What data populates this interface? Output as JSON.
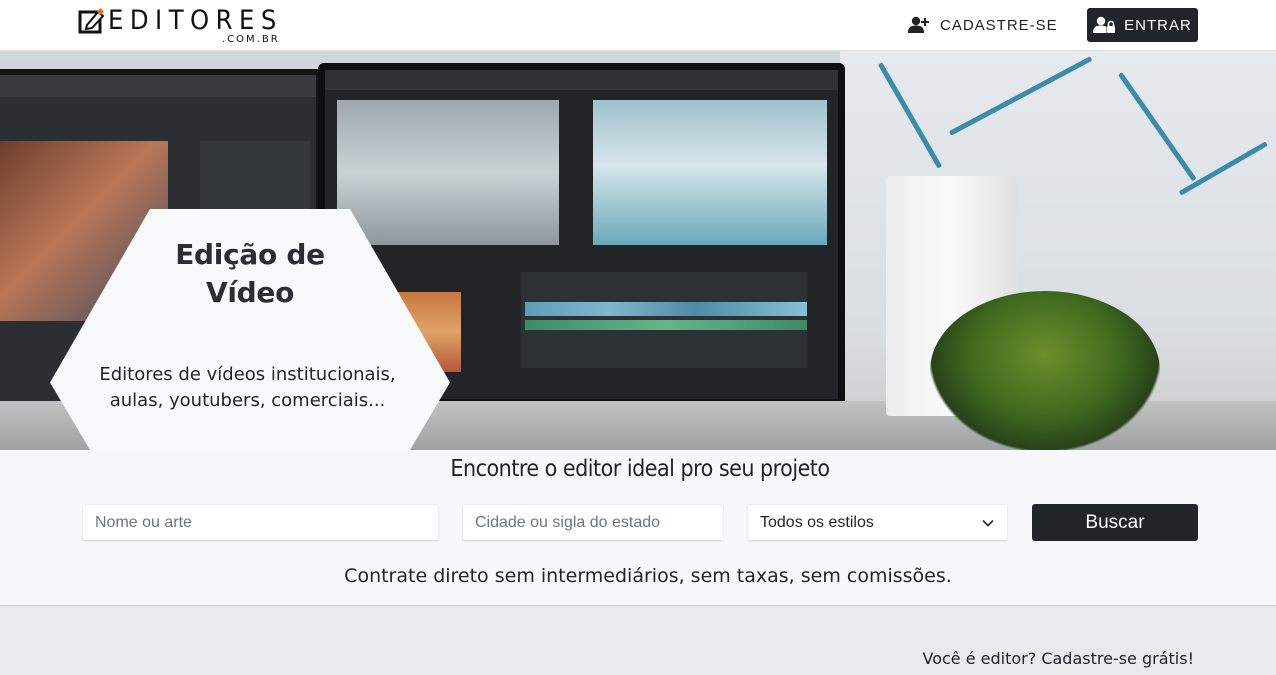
{
  "header": {
    "logo_text": "EDITORES",
    "logo_sub": ".COM.BR",
    "signup_label": "CADASTRE-SE",
    "login_label": "ENTRAR"
  },
  "hero": {
    "title": "Edição de Vídeo",
    "description": "Editores de vídeos institucionais, aulas, youtubers, comerciais..."
  },
  "search": {
    "heading": "Encontre o editor ideal pro seu projeto",
    "name_placeholder": "Nome ou arte",
    "city_placeholder": "Cidade ou sigla do estado",
    "style_selected": "Todos os estilos",
    "button_label": "Buscar",
    "tagline": "Contrate direto sem intermediários, sem taxas, sem comissões."
  },
  "footer": {
    "cta": "Você é editor? Cadastre-se grátis!"
  },
  "colors": {
    "dark": "#212529",
    "logo_accent": "#e8731a",
    "section_bg": "#f7f8f9",
    "bottom_bg": "#e8eaec"
  },
  "icons": {
    "logo": "pencil-square-icon",
    "signup": "user-plus-icon",
    "login": "user-lock-icon",
    "select": "chevron-down-icon"
  }
}
